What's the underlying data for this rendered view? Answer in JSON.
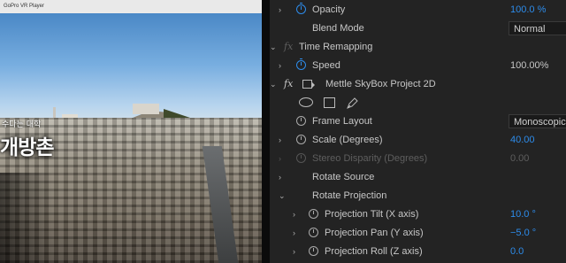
{
  "player": {
    "window_title": "GoPro VR Player",
    "overlay_small": "수다는 대학",
    "overlay_text": "개방촌"
  },
  "effects": {
    "opacity": {
      "label": "Opacity",
      "value": "100.0 %"
    },
    "blend_mode": {
      "label": "Blend Mode",
      "value": "Normal"
    },
    "time_remapping": {
      "fx": "fx",
      "label": "Time Remapping"
    },
    "speed": {
      "label": "Speed",
      "value": "100.00%"
    },
    "skybox": {
      "fx": "fx",
      "label": "Mettle SkyBox Project 2D"
    },
    "frame_layout": {
      "label": "Frame Layout",
      "value": "Monoscopic"
    },
    "scale": {
      "label": "Scale (Degrees)",
      "value": "40.00"
    },
    "stereo_disparity": {
      "label": "Stereo Disparity (Degrees)",
      "value": "0.00"
    },
    "rotate_source": {
      "label": "Rotate Source"
    },
    "rotate_projection": {
      "label": "Rotate Projection"
    },
    "projection_tilt": {
      "label": "Projection Tilt (X axis)",
      "value": "10.0 °"
    },
    "projection_pan": {
      "label": "Projection Pan (Y axis)",
      "value": "−5.0 °"
    },
    "projection_roll": {
      "label": "Projection Roll (Z axis)",
      "value": "0.0"
    }
  },
  "colors": {
    "panel_bg": "#232323",
    "accent_blue": "#2d8ceb",
    "label_gray": "#c7c7c7",
    "disabled_gray": "#5e5e5e"
  },
  "icons": [
    "chevron-right-icon",
    "chevron-down-icon",
    "stopwatch-icon",
    "fx-badge-icon",
    "transform-icon",
    "ellipse-mask-icon",
    "rectangle-mask-icon",
    "pen-mask-icon"
  ]
}
